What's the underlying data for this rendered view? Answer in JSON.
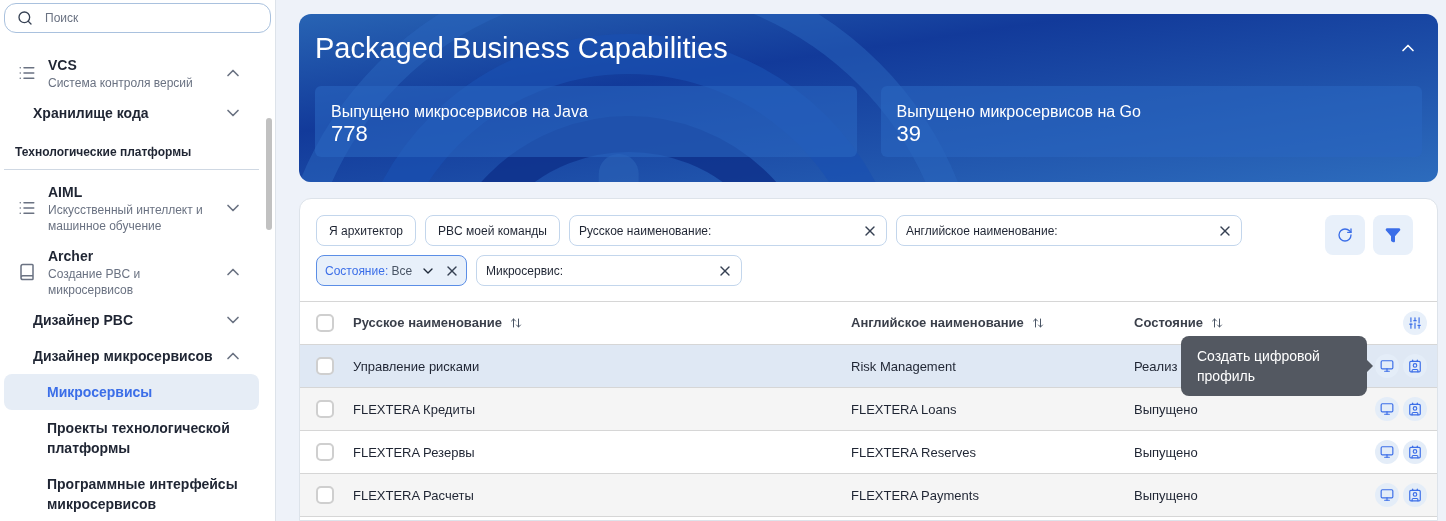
{
  "sidebar": {
    "search": {
      "placeholder": "Поиск"
    },
    "nav": [
      {
        "kind": "group",
        "title": "VCS",
        "subtitle": "Система контроля версий",
        "expanded": true,
        "children": [
          {
            "kind": "folder",
            "label": "Хранилище кода",
            "expanded": false
          }
        ]
      },
      {
        "kind": "section",
        "label": "Технологические платформы"
      },
      {
        "kind": "group",
        "title": "AIML",
        "subtitle": "Искусственный интеллект и машинное обучение",
        "expanded": false
      },
      {
        "kind": "group",
        "title": "Archer",
        "subtitle": "Создание PBC и микросервисов",
        "expanded": true,
        "children": [
          {
            "kind": "folder",
            "label": "Дизайнер PBC",
            "expanded": false
          },
          {
            "kind": "folder",
            "label": "Дизайнер микросервисов",
            "expanded": true,
            "children": [
              {
                "kind": "leaf",
                "label": "Микросервисы",
                "selected": true
              },
              {
                "kind": "leaf",
                "label": "Проекты технологической платформы",
                "selected": false
              },
              {
                "kind": "leaf",
                "label": "Программные интерфейсы микросервисов",
                "selected": false
              }
            ]
          }
        ]
      }
    ]
  },
  "banner": {
    "title": "Packaged Business Capabilities",
    "expanded": true,
    "stats": [
      {
        "label": "Выпущено микросервисов на Java",
        "value": "778"
      },
      {
        "label": "Выпущено микросервисов на Go",
        "value": "39"
      }
    ]
  },
  "filters": [
    {
      "kind": "toggle",
      "label": "Я архитектор"
    },
    {
      "kind": "toggle",
      "label": "PBC моей команды"
    },
    {
      "kind": "field",
      "label": "Русское наименование:"
    },
    {
      "kind": "field",
      "label": "Английское наименование:"
    },
    {
      "kind": "select",
      "label": "Состояние:",
      "value": "Все"
    },
    {
      "kind": "field",
      "label": "Микросервис:"
    }
  ],
  "table": {
    "all_checked": false,
    "columns": [
      "Русское наименование",
      "Английское наименование",
      "Состояние"
    ],
    "rows": [
      {
        "checked": false,
        "hovered": true,
        "cells": [
          "Управление рисками",
          "Risk Management",
          "Реализ"
        ],
        "tooltip": "Создать цифровой профиль"
      },
      {
        "checked": false,
        "hovered": false,
        "cells": [
          "FLEXTERA Кредиты",
          "FLEXTERA Loans",
          "Выпущено"
        ]
      },
      {
        "checked": false,
        "hovered": false,
        "cells": [
          "FLEXTERA Резервы",
          "FLEXTERA Reserves",
          "Выпущено"
        ]
      },
      {
        "checked": false,
        "hovered": false,
        "cells": [
          "FLEXTERA Расчеты",
          "FLEXTERA Payments",
          "Выпущено"
        ]
      }
    ]
  }
}
